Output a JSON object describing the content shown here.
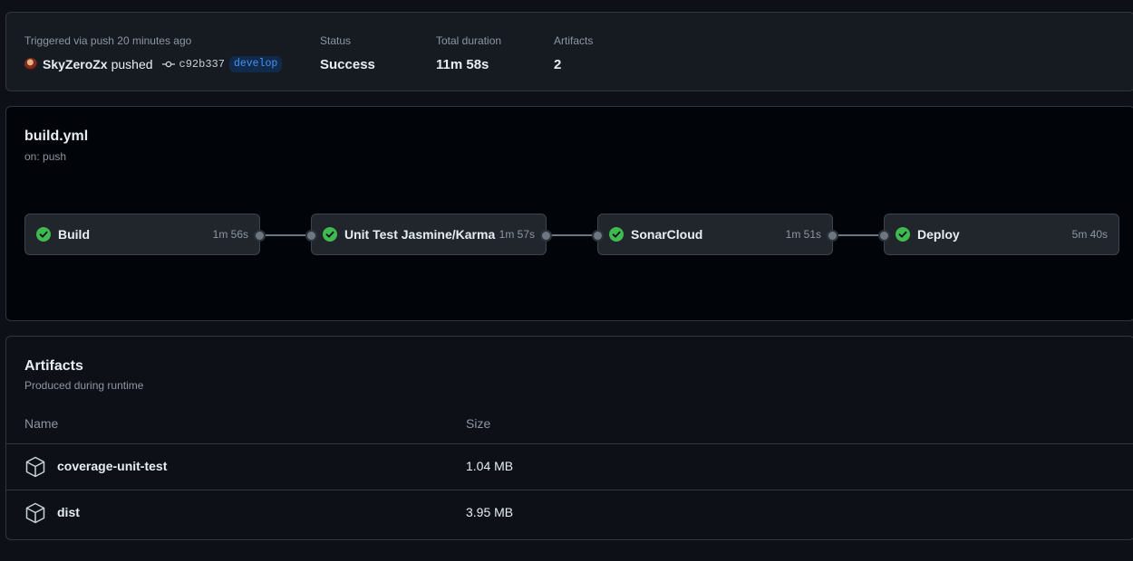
{
  "summary": {
    "trigger_label": "Triggered via push 20 minutes ago",
    "actor": "SkyZeroZx",
    "action": "pushed",
    "commit_sha": "c92b337",
    "branch": "develop",
    "status_label": "Status",
    "status_value": "Success",
    "duration_label": "Total duration",
    "duration_value": "11m 58s",
    "artifacts_label": "Artifacts",
    "artifacts_value": "2"
  },
  "workflow": {
    "title": "build.yml",
    "subtitle": "on: push",
    "jobs": [
      {
        "name": "Build",
        "duration": "1m 56s",
        "status": "success"
      },
      {
        "name": "Unit Test Jasmine/Karma",
        "duration": "1m 57s",
        "status": "success"
      },
      {
        "name": "SonarCloud",
        "duration": "1m 51s",
        "status": "success"
      },
      {
        "name": "Deploy",
        "duration": "5m 40s",
        "status": "success"
      }
    ]
  },
  "artifacts": {
    "title": "Artifacts",
    "subtitle": "Produced during runtime",
    "col_name": "Name",
    "col_size": "Size",
    "rows": [
      {
        "name": "coverage-unit-test",
        "size": "1.04 MB",
        "icon": "package-icon"
      },
      {
        "name": "dist",
        "size": "3.95 MB",
        "icon": "package-icon"
      }
    ]
  },
  "colors": {
    "background": "#0d1117",
    "success": "#3fb950",
    "branch_text": "#4493f8"
  }
}
